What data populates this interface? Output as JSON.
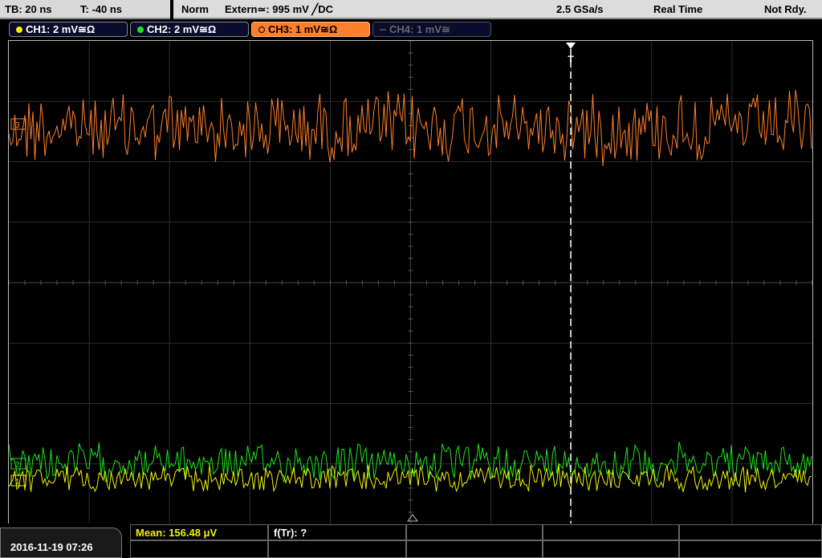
{
  "timebase": {
    "tb": "TB: 20 ns",
    "trig_pos": "T: -40 ns"
  },
  "status": {
    "mode": "Norm",
    "trigger": "Extern≃: 995 mV ╱DC",
    "sample_rate": "2.5 GSa/s",
    "acq": "Real Time",
    "state": "Not Rdy."
  },
  "channels": [
    {
      "label": "CH1: 2 mV≅Ω",
      "color": "#f2f200",
      "active": true
    },
    {
      "label": "CH2: 2 mV≅Ω",
      "color": "#19e619",
      "active": true
    },
    {
      "label": "CH3: 1 mV≅Ω",
      "color": "#ff7f2a",
      "active": true,
      "selected": true
    },
    {
      "label": "CH4: 1 mV≅",
      "color": "#666666",
      "active": false
    }
  ],
  "markers": {
    "trigger": "T",
    "ch1": "1",
    "ch2": "2",
    "ch3": "3"
  },
  "bottom": {
    "datetime": "2016-11-19 07:26",
    "mean": "Mean: 156.48 μV",
    "ftr": "f(Tr): ?"
  },
  "colors": {
    "grid": "#3a3a3a",
    "trigger_line": "#ffffff"
  }
}
